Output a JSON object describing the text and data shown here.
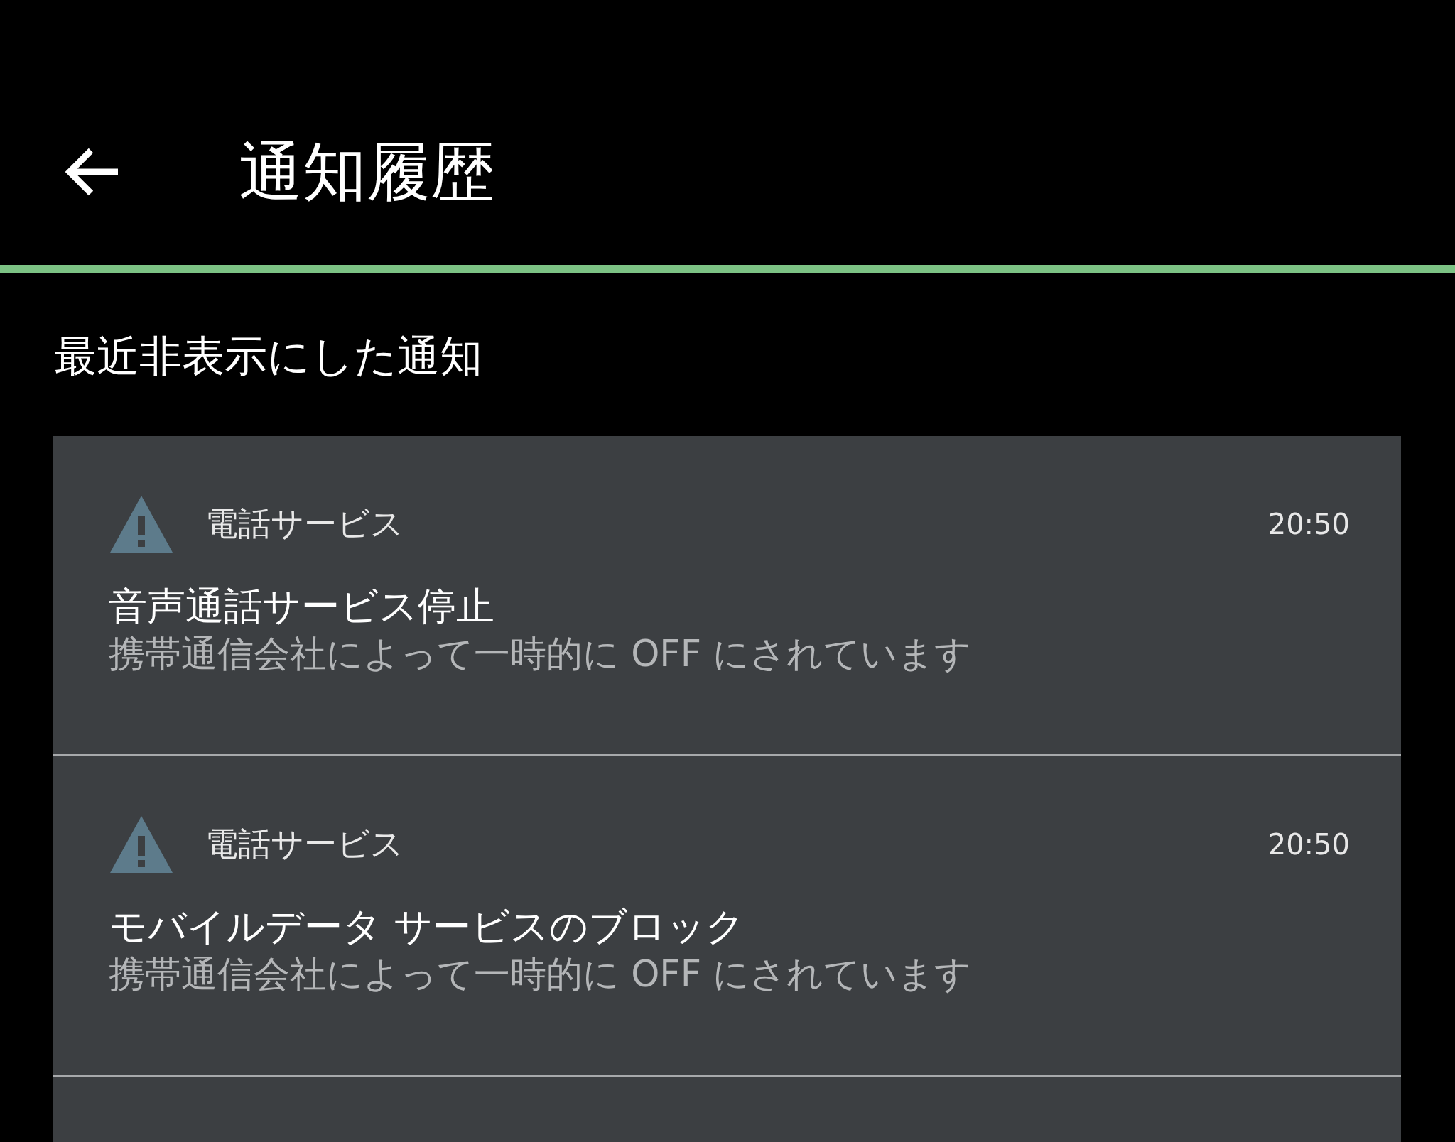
{
  "app_bar": {
    "title": "通知履歴"
  },
  "section": {
    "title": "最近非表示にした通知"
  },
  "notifications": [
    {
      "app": "電話サービス",
      "time": "20:50",
      "title": "音声通話サービス停止",
      "text": "携帯通信会社によって一時的に OFF にされています"
    },
    {
      "app": "電話サービス",
      "time": "20:50",
      "title": "モバイルデータ サービスのブロック",
      "text": "携帯通信会社によって一時的に OFF にされています"
    }
  ]
}
